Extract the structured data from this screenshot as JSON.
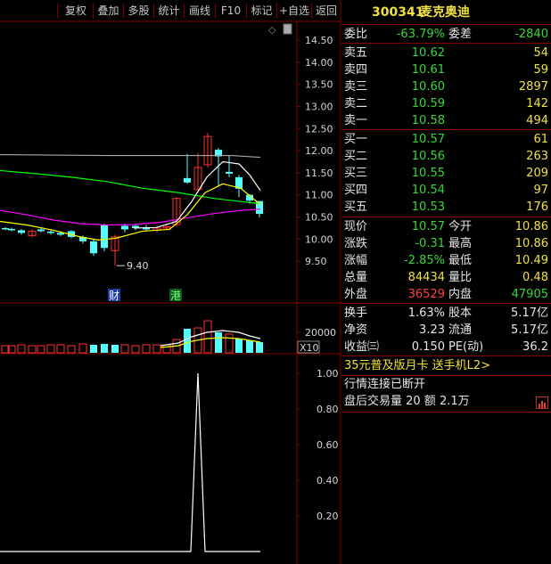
{
  "toolbar": {
    "items": [
      "复权",
      "叠加",
      "多股",
      "统计",
      "画线",
      "F10",
      "标记",
      "+自选",
      "返回"
    ]
  },
  "chart": {
    "price_ticks": [
      "14.50",
      "14.00",
      "13.50",
      "13.00",
      "12.50",
      "12.00",
      "11.50",
      "11.00",
      "10.50",
      "10.00",
      "9.50"
    ],
    "volume_tick": "20000",
    "volume_unit": "X10",
    "indicator_ticks": [
      "1.00",
      "0.80",
      "0.60",
      "0.40",
      "0.20"
    ],
    "low_marker": "9.40",
    "badge_cai": "财",
    "badge_gang": "港",
    "small_icon": "◇",
    "colors": {
      "up_candle": "#ff3030",
      "down_candle": "#54ffff",
      "ma_white": "#ffffff",
      "ma_yellow": "#ffff00",
      "ma_magenta": "#ff00ff",
      "ma_green": "#00ff00",
      "ma_gray": "#aaaaaa",
      "grid": "#800000"
    }
  },
  "panel": {
    "code": "300341",
    "name": "麦克奥迪",
    "ratio": {
      "label": "委比",
      "value": "-63.79%",
      "label2": "委差",
      "value2": "-2840"
    },
    "asks": [
      {
        "label": "卖五",
        "price": "10.62",
        "vol": "54"
      },
      {
        "label": "卖四",
        "price": "10.61",
        "vol": "59"
      },
      {
        "label": "卖三",
        "price": "10.60",
        "vol": "2897"
      },
      {
        "label": "卖二",
        "price": "10.59",
        "vol": "142"
      },
      {
        "label": "卖一",
        "price": "10.58",
        "vol": "494"
      }
    ],
    "bids": [
      {
        "label": "买一",
        "price": "10.57",
        "vol": "61"
      },
      {
        "label": "买二",
        "price": "10.56",
        "vol": "263"
      },
      {
        "label": "买三",
        "price": "10.55",
        "vol": "209"
      },
      {
        "label": "买四",
        "price": "10.54",
        "vol": "97"
      },
      {
        "label": "买五",
        "price": "10.53",
        "vol": "176"
      }
    ],
    "quotes": [
      {
        "l1": "现价",
        "v1": "10.57",
        "l2": "今开",
        "v2": "10.86"
      },
      {
        "l1": "涨跌",
        "v1": "-0.31",
        "l2": "最高",
        "v2": "10.86"
      },
      {
        "l1": "涨幅",
        "v1": "-2.85%",
        "l2": "最低",
        "v2": "10.49"
      },
      {
        "l1": "总量",
        "v1": "84434",
        "l2": "量比",
        "v2": "0.48"
      },
      {
        "l1": "外盘",
        "v1": "36529",
        "l2": "内盘",
        "v2": "47905"
      }
    ],
    "fundamentals": [
      {
        "l1": "换手",
        "v1": "1.63%",
        "l2": "股本",
        "v2": "5.17亿"
      },
      {
        "l1": "净资",
        "v1": "3.23",
        "l2": "流通",
        "v2": "5.17亿"
      },
      {
        "l1": "收益㈢",
        "v1": "0.150",
        "l2": "PE(动)",
        "v2": "36.2"
      }
    ],
    "promo": "35元普及版月卡 送手机L2>",
    "status": "行情连接已断开",
    "after_hours": "盘后交易量 20 额 2.1万",
    "chart_icon": "bar-chart-icon"
  }
}
